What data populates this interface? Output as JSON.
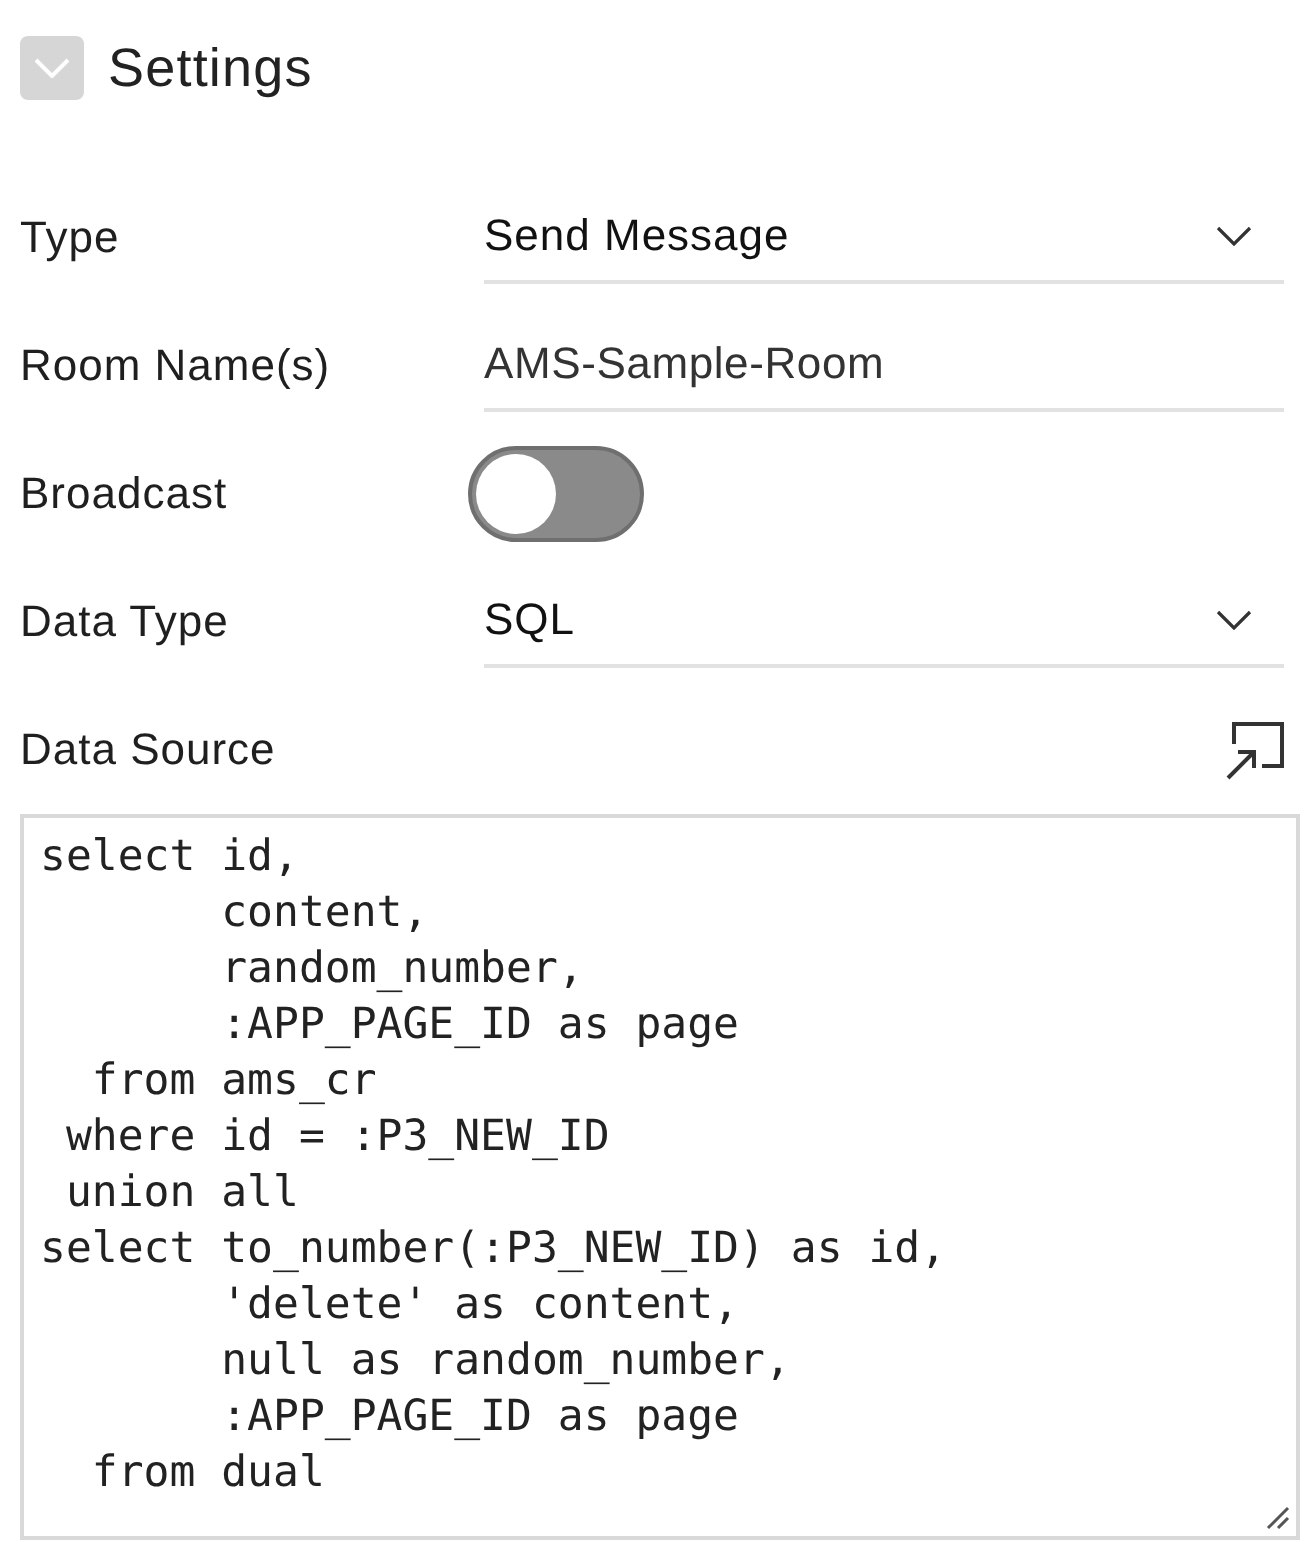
{
  "header": {
    "title": "Settings",
    "expanded": true
  },
  "fields": [
    {
      "kind": "select",
      "label": "Type",
      "value": "Send Message"
    },
    {
      "kind": "text",
      "label": "Room Name(s)",
      "value": "AMS-Sample-Room"
    },
    {
      "kind": "switch",
      "label": "Broadcast",
      "on": false
    },
    {
      "kind": "select",
      "label": "Data Type",
      "value": "SQL"
    },
    {
      "kind": "code",
      "label": "Data Source",
      "value": "select id,\n       content,\n       random_number,\n       :APP_PAGE_ID as page\n  from ams_cr\n where id = :P3_NEW_ID\n union all\nselect to_number(:P3_NEW_ID) as id,\n       'delete' as content,\n       null as random_number,\n       :APP_PAGE_ID as page\n  from dual"
    }
  ]
}
